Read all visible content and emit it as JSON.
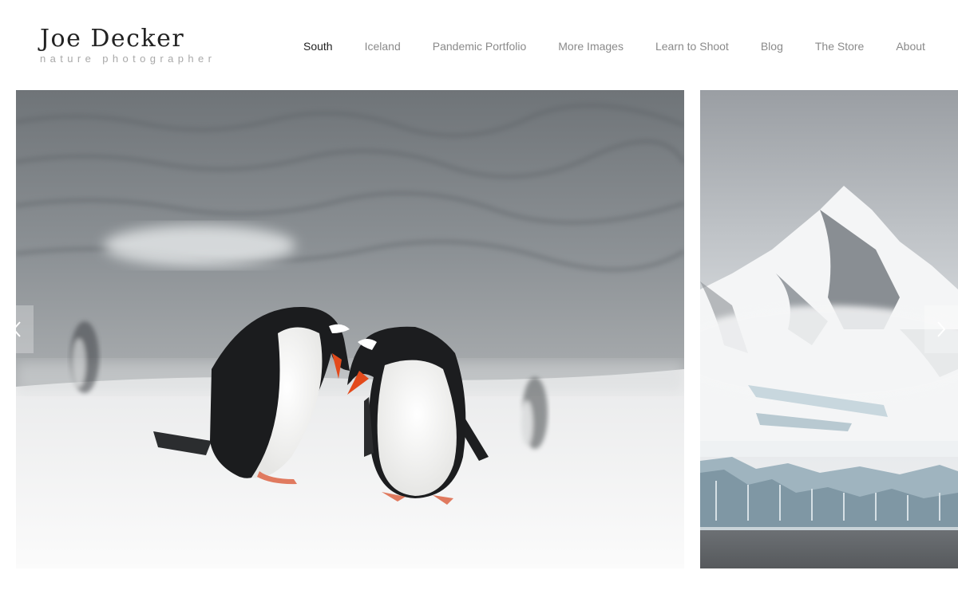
{
  "site": {
    "title": "Joe Decker",
    "tagline": "nature photographer"
  },
  "nav": {
    "items": [
      {
        "label": "South",
        "active": true
      },
      {
        "label": "Iceland",
        "active": false
      },
      {
        "label": "Pandemic Portfolio",
        "active": false
      },
      {
        "label": "More Images",
        "active": false
      },
      {
        "label": "Learn to Shoot",
        "active": false
      },
      {
        "label": "Blog",
        "active": false
      },
      {
        "label": "The Store",
        "active": false
      },
      {
        "label": "About",
        "active": false
      }
    ]
  },
  "slider": {
    "prev_icon": "chevron-left-icon",
    "next_icon": "chevron-right-icon",
    "slides": [
      {
        "subject": "gentoo penguins in snowfall"
      },
      {
        "subject": "snowy mountains and glacier"
      }
    ]
  },
  "colors": {
    "nav_active": "#222222",
    "nav_inactive": "#8a8a8a",
    "tagline": "#a9a9a9"
  }
}
